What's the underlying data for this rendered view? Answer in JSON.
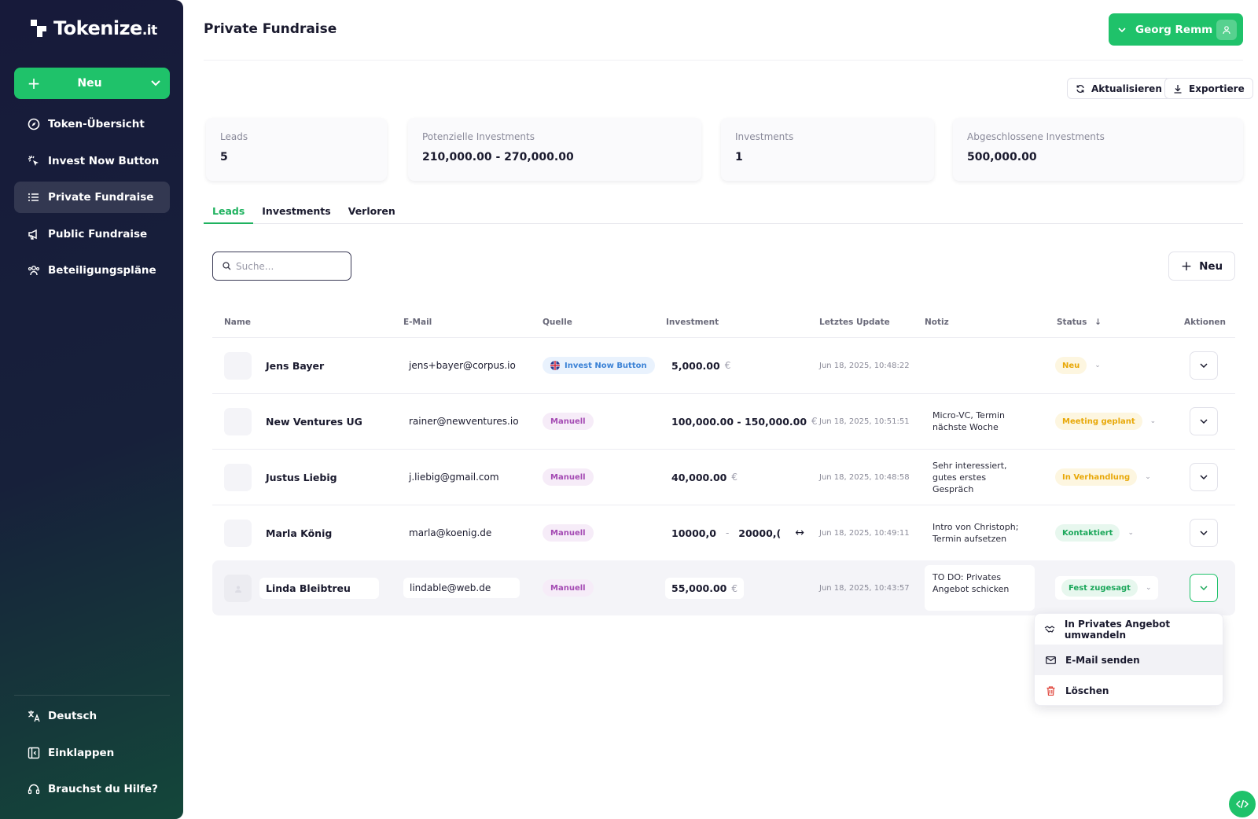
{
  "brand": {
    "name": "Tokenize",
    "suffix": ".it",
    "accent": "#1fc26a"
  },
  "sidebar": {
    "new_label": "Neu",
    "items": [
      {
        "label": "Token-Übersicht",
        "icon": "compass-icon"
      },
      {
        "label": "Invest Now Button",
        "icon": "click-icon"
      },
      {
        "label": "Private Fundraise",
        "icon": "list-icon",
        "active": true
      },
      {
        "label": "Public Fundraise",
        "icon": "megaphone-icon"
      },
      {
        "label": "Beteiligungspläne",
        "icon": "users-icon"
      }
    ],
    "bottom": [
      {
        "label": "Deutsch",
        "icon": "translate-icon"
      },
      {
        "label": "Einklappen",
        "icon": "collapse-icon"
      },
      {
        "label": "Brauchst du Hilfe?",
        "icon": "headset-icon"
      }
    ]
  },
  "header": {
    "title": "Private Fundraise",
    "user_name": "Georg Remm"
  },
  "toolbar": {
    "refresh_label": "Aktualisieren",
    "export_label": "Exportiere"
  },
  "stats": [
    {
      "label": "Leads",
      "value": "5"
    },
    {
      "label": "Potenzielle Investments",
      "value": "210,000.00 - 270,000.00"
    },
    {
      "label": "Investments",
      "value": "1"
    },
    {
      "label": "Abgeschlossene Investments",
      "value": "500,000.00"
    }
  ],
  "tabs": [
    {
      "label": "Leads",
      "active": true
    },
    {
      "label": "Investments"
    },
    {
      "label": "Verloren"
    }
  ],
  "search": {
    "placeholder": "Suche..."
  },
  "new_lead_label": "Neu",
  "table": {
    "columns": [
      "Name",
      "E-Mail",
      "Quelle",
      "Investment",
      "Letztes Update",
      "Notiz",
      "Status",
      "Aktionen"
    ],
    "currency": "€",
    "rows": [
      {
        "name": "Jens Bayer",
        "email": "jens+bayer@corpus.io",
        "source": "Invest Now Button",
        "investment": "5,000.00",
        "updated": "Jun 18, 2025, 10:48:22",
        "note": "",
        "status": "Neu"
      },
      {
        "name": "New Ventures UG",
        "email": "rainer@newventures.io",
        "source": "Manuell",
        "investment": "100,000.00 - 150,000.00",
        "updated": "Jun 18, 2025, 10:51:51",
        "note": "Micro-VC, Termin nächste Woche",
        "status": "Meeting geplant"
      },
      {
        "name": "Justus Liebig",
        "email": "j.liebig@gmail.com",
        "source": "Manuell",
        "investment": "40,000.00",
        "updated": "Jun 18, 2025, 10:48:58",
        "note": "Sehr interessiert, gutes erstes Gespräch",
        "status": "In Verhandlung"
      },
      {
        "name": "Marla König",
        "email": "marla@koenig.de",
        "source": "Manuell",
        "investment_from": "10000,0",
        "investment_sep": "-",
        "investment_to": "20000,(",
        "updated": "Jun 18, 2025, 10:49:11",
        "note": "Intro von Christoph; Termin aufsetzen",
        "status": "Kontaktiert"
      },
      {
        "name": "Linda Bleibtreu",
        "email": "lindable@web.de",
        "source": "Manuell",
        "investment": "55,000.00",
        "updated": "Jun 18, 2025, 10:43:57",
        "note": "TO DO: Privates Angebot schicken",
        "status": "Fest zugesagt"
      }
    ]
  },
  "row_menu": {
    "items": [
      {
        "label": "In Privates Angebot umwandeln",
        "icon": "handshake-icon"
      },
      {
        "label": "E-Mail senden",
        "icon": "mail-icon"
      },
      {
        "label": "Löschen",
        "icon": "trash-icon"
      }
    ]
  }
}
